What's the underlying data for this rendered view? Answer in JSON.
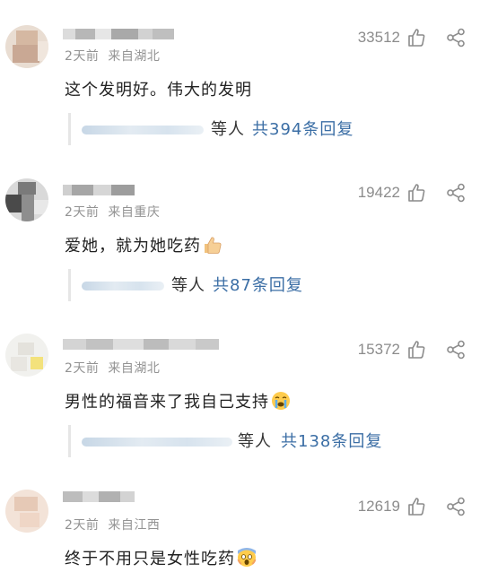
{
  "comments": [
    {
      "meta_time": "2天前",
      "meta_location": "来自湖北",
      "text": "这个发明好。伟大的发明",
      "likes": "33512",
      "reply_people": "等人",
      "reply_count": "共394条回复"
    },
    {
      "meta_time": "2天前",
      "meta_location": "来自重庆",
      "text": "爱她，就为她吃药",
      "emoji": "thumbs-up-icon",
      "likes": "19422",
      "reply_people": "等人",
      "reply_count": "共87条回复"
    },
    {
      "meta_time": "2天前",
      "meta_location": "来自湖北",
      "text": "男性的福音来了我自己支持",
      "emoji": "crying-face-icon",
      "likes": "15372",
      "reply_people": "等人",
      "reply_count": "共138条回复"
    },
    {
      "meta_time": "2天前",
      "meta_location": "来自江西",
      "text": "终于不用只是女性吃药",
      "emoji": "screaming-face-icon",
      "likes": "12619"
    }
  ],
  "colors": {
    "meta": "#939393",
    "likes": "#8c8c8c",
    "reply_link": "#3b6ea5",
    "divider": "#e6e6e6"
  }
}
